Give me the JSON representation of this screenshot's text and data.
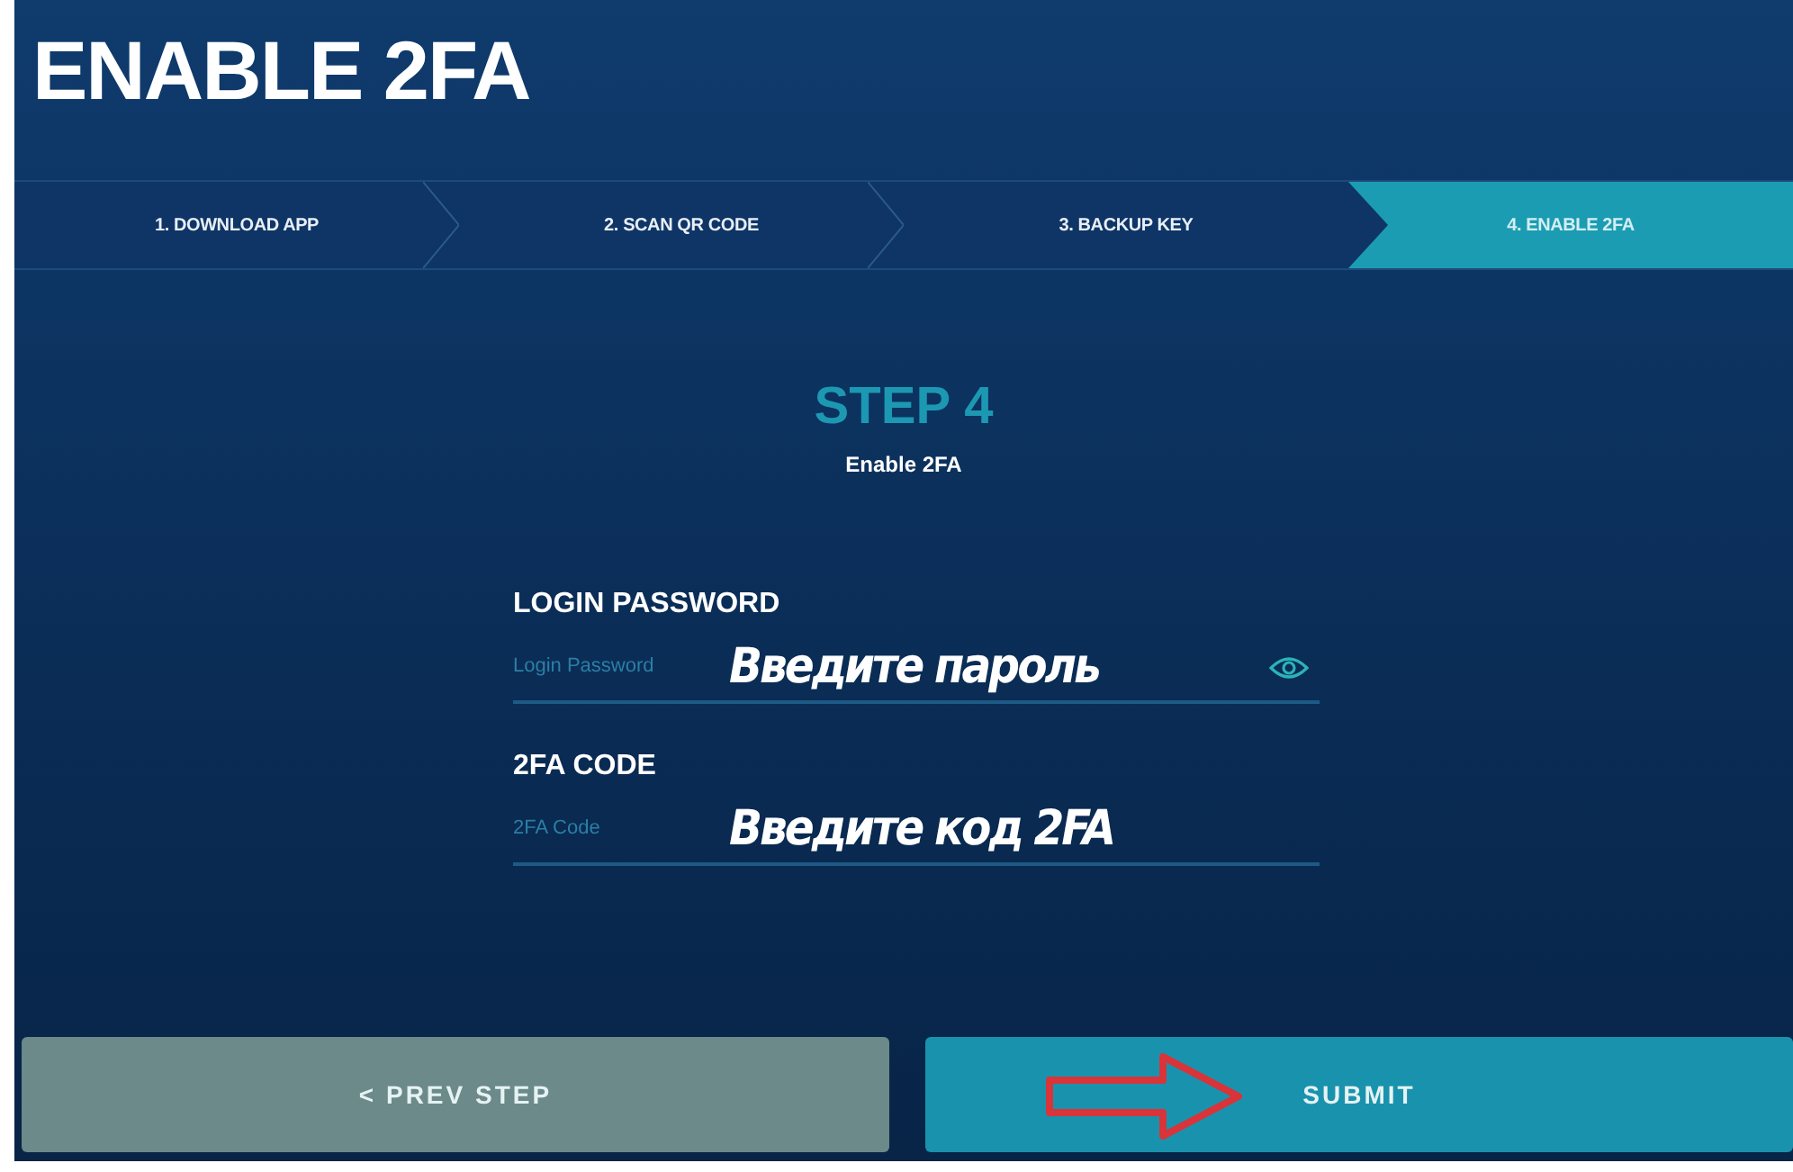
{
  "title": "ENABLE 2FA",
  "steps": [
    {
      "label": "1. DOWNLOAD APP",
      "selected": false
    },
    {
      "label": "2. SCAN QR CODE",
      "selected": false
    },
    {
      "label": "3. BACKUP KEY",
      "selected": false
    },
    {
      "label": "4. ENABLE 2FA",
      "selected": true
    }
  ],
  "heading": "STEP 4",
  "subheading": "Enable 2FA",
  "fields": [
    {
      "label": "LOGIN PASSWORD",
      "placeholder": "Login Password",
      "annotation": "Введите пароль",
      "kind": "password"
    },
    {
      "label": "2FA CODE",
      "placeholder": "2FA Code",
      "annotation": "Введите код 2FA",
      "kind": "text"
    }
  ],
  "buttons": [
    {
      "label": "< PREV STEP",
      "kind": "secondary"
    },
    {
      "label": "SUBMIT",
      "kind": "primary",
      "annotated": true
    }
  ]
}
